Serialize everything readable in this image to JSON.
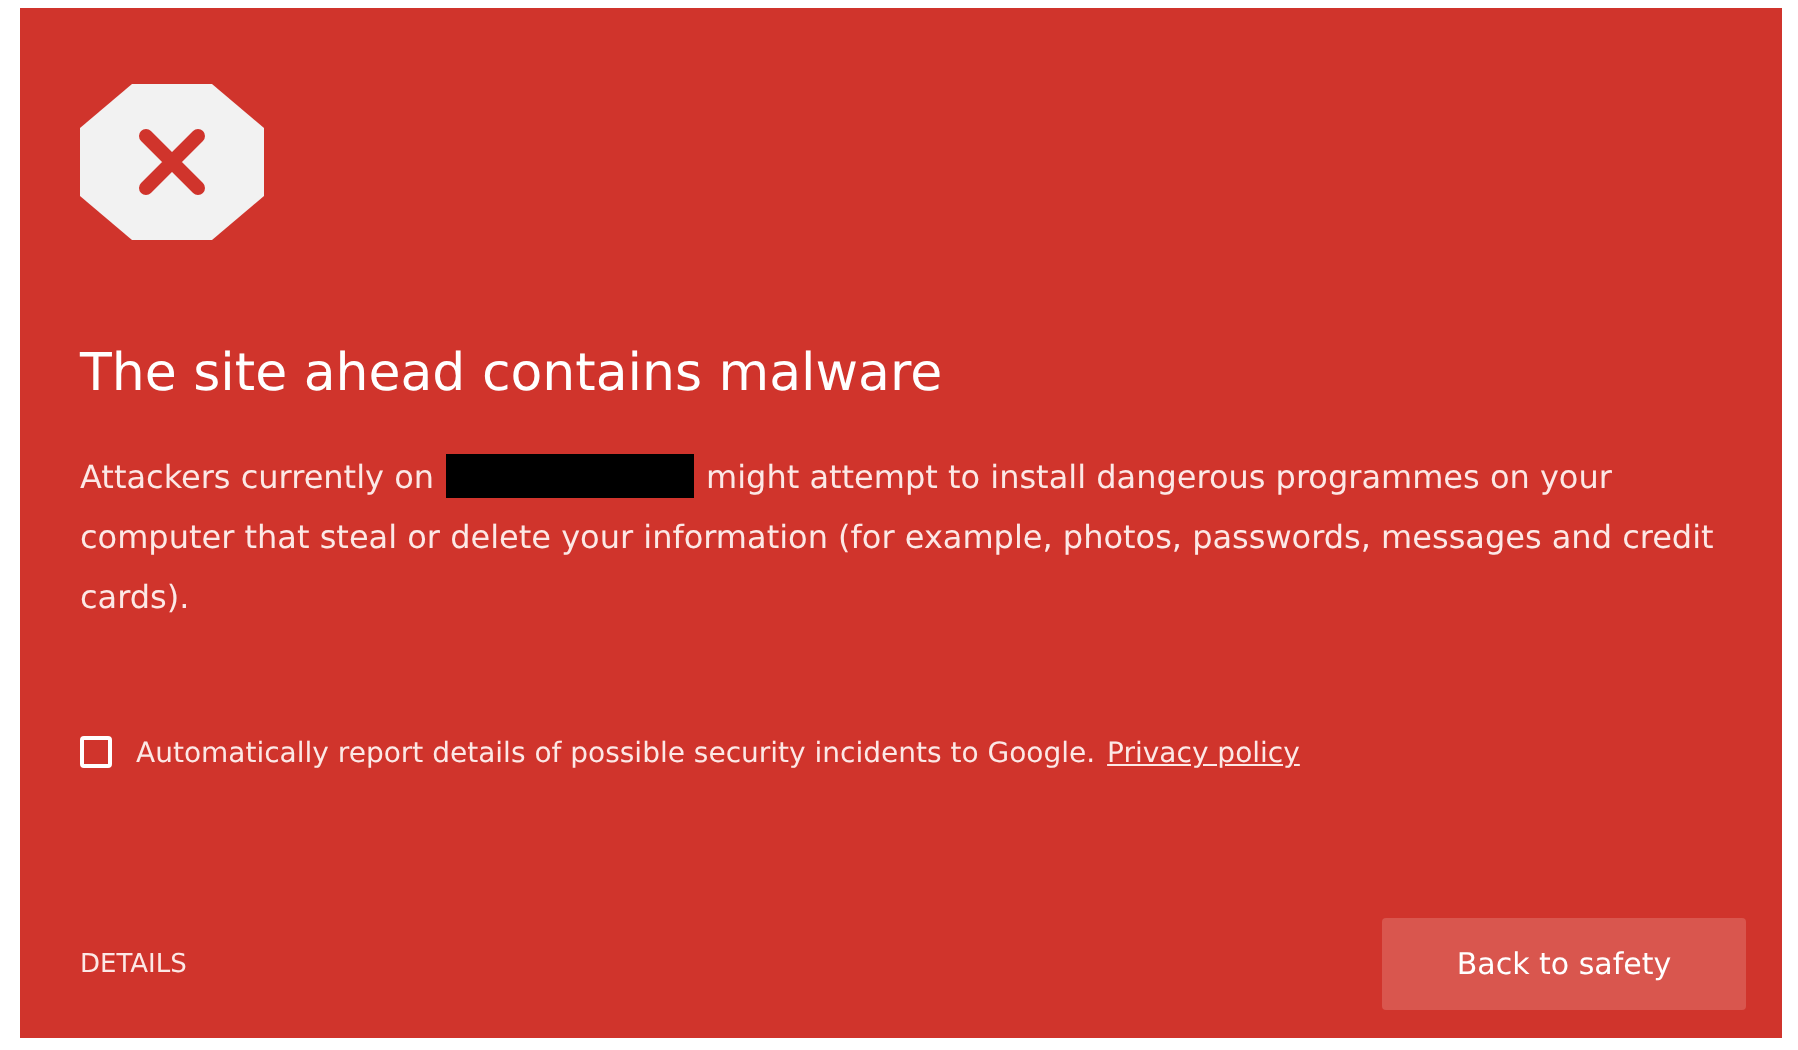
{
  "title": "The site ahead contains malware",
  "message": {
    "before": "Attackers currently on",
    "redacted": true,
    "after": "might attempt to install dangerous programmes on your computer that steal or delete your information (for example, photos, passwords, messages and credit cards)."
  },
  "report": {
    "checked": false,
    "label": "Automatically report details of possible security incidents to Google.",
    "link": "Privacy policy"
  },
  "details": "DETAILS",
  "back_button": "Back to safety"
}
